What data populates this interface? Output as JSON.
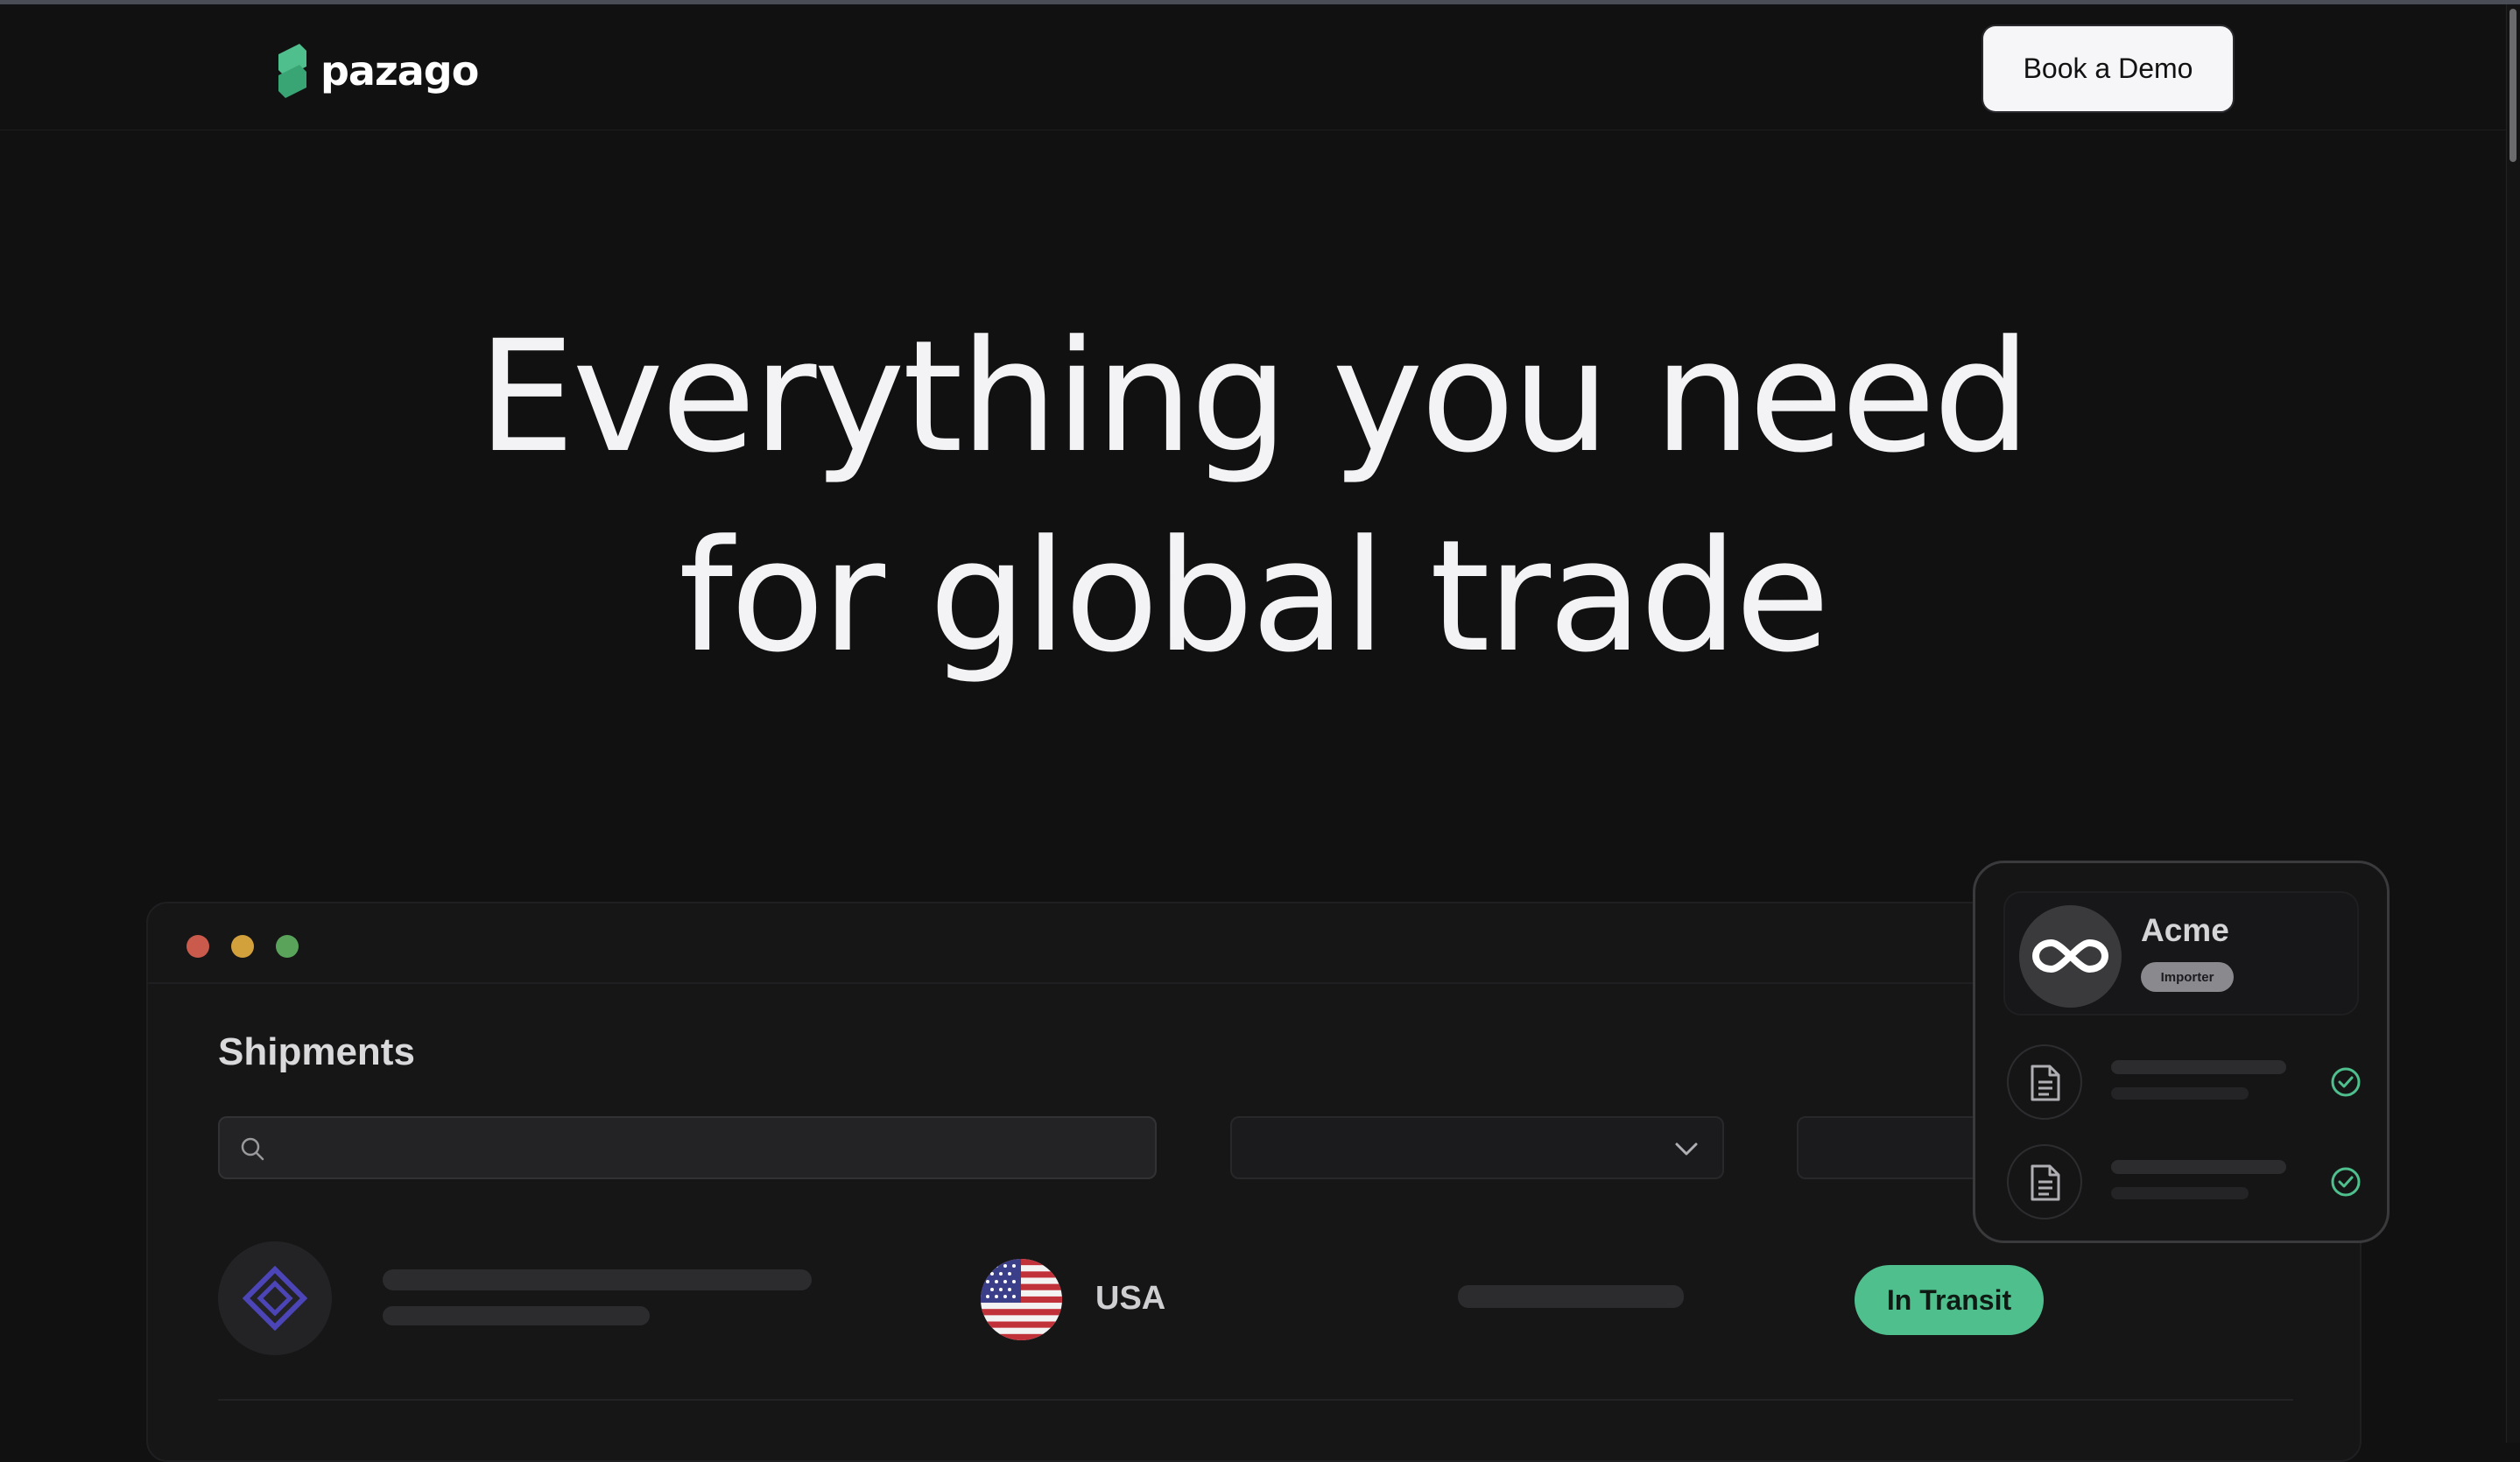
{
  "nav": {
    "brand": "pazago",
    "cta_label": "Book a Demo"
  },
  "hero": {
    "line1": "Everything you need",
    "line2": "for global trade"
  },
  "app": {
    "title": "Shipments",
    "search": {
      "placeholder": ""
    },
    "rows": [
      {
        "country": "USA",
        "status": "In Transit"
      }
    ]
  },
  "card": {
    "company": "Acme",
    "role": "Importer",
    "documents": [
      {
        "icon": "document-icon",
        "verified": true
      },
      {
        "icon": "document-icon",
        "verified": true
      }
    ]
  },
  "colors": {
    "background": "#111112",
    "brand_green": "#4fc08d",
    "cta_bg": "#f6f6f8",
    "status_transit": "#4fc08d",
    "window_red": "#c95a4c",
    "window_yellow": "#d3a13c",
    "window_green": "#5aa35a"
  }
}
